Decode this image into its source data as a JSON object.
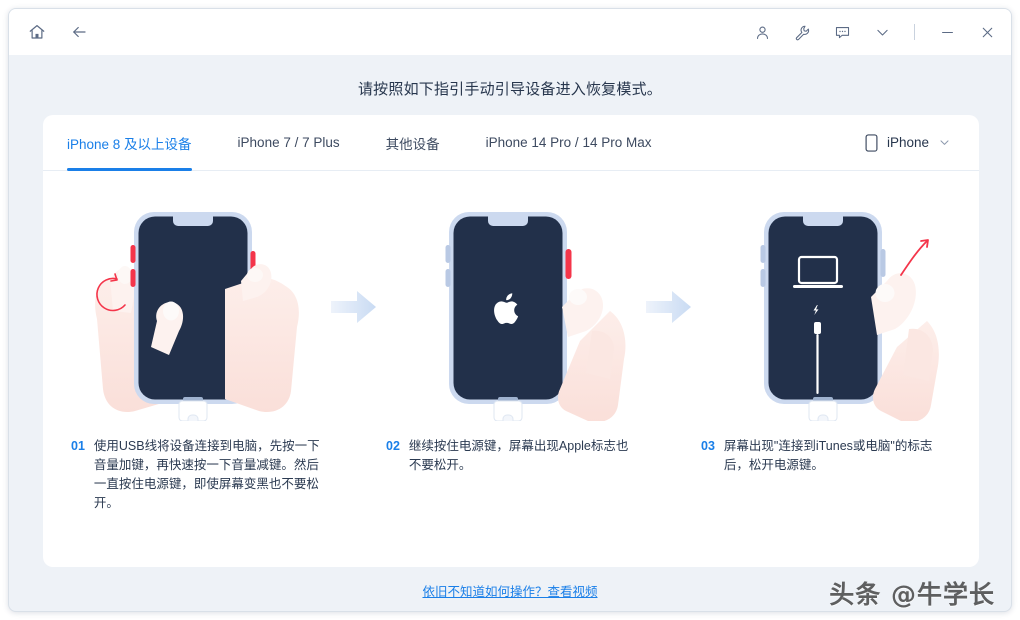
{
  "titlebar": {
    "left_icons": [
      {
        "name": "home-icon",
        "label": "主页"
      },
      {
        "name": "back-arrow-icon",
        "label": "返回"
      }
    ],
    "right_icons": [
      {
        "name": "user-account-icon",
        "label": "账户"
      },
      {
        "name": "wrench-tools-icon",
        "label": "工具"
      },
      {
        "name": "feedback-message-icon",
        "label": "反馈"
      },
      {
        "name": "chevron-down-icon",
        "label": "更多"
      }
    ],
    "window_controls": [
      {
        "name": "minimize-button",
        "label": "—"
      },
      {
        "name": "close-button",
        "label": "✕"
      }
    ]
  },
  "heading": {
    "title": "请按照如下指引手动引导设备进入恢复模式。"
  },
  "tabs": [
    {
      "label": "iPhone 8 及以上设备",
      "active": true
    },
    {
      "label": "iPhone 7 / 7 Plus",
      "active": false
    },
    {
      "label": "其他设备",
      "active": false
    },
    {
      "label": "iPhone 14 Pro / 14 Pro Max",
      "active": false
    }
  ],
  "device_select": {
    "icon": "phone-icon",
    "value": "iPhone",
    "chevron": "chevron-down-icon"
  },
  "steps": [
    {
      "num": "01",
      "desc": "使用USB线将设备连接到电脑，先按一下音量加键，再快速按一下音量减键。然后一直按住电源键，即使屏幕变黑也不要松开。",
      "illustration": "phone-two-hands-volume-buttons"
    },
    {
      "num": "02",
      "desc": "继续按住电源键，屏幕出现Apple标志也不要松开。",
      "illustration": "phone-apple-logo-hand-power-button"
    },
    {
      "num": "03",
      "desc": "屏幕出现\"连接到iTunes或电脑\"的标志后，松开电源键。",
      "illustration": "phone-recovery-mode-screen-hand-release"
    }
  ],
  "arrows": [
    {
      "name": "step-arrow-1"
    },
    {
      "name": "step-arrow-2"
    }
  ],
  "footer": {
    "link_text": "依旧不知道如何操作？查看视频"
  },
  "watermark": {
    "text": "头条 @牛学长"
  },
  "colors": {
    "accent": "#1a7fe8",
    "app_background": "#eef2f7",
    "card_background": "#ffffff",
    "text_primary": "#27364d",
    "phone_screen": "#22304a",
    "phone_frame": "#ccd9ef",
    "highlight_red": "#f4354a",
    "skin": "#fbe3de"
  }
}
